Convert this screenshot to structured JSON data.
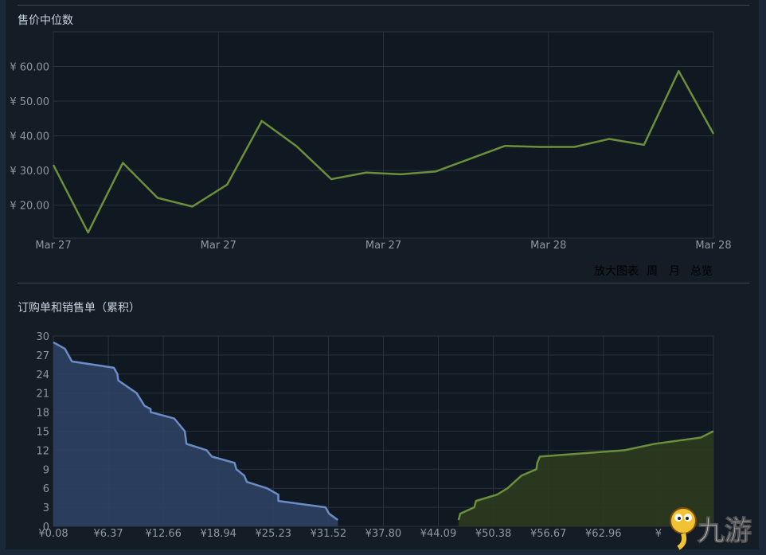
{
  "chart_data": [
    {
      "type": "line",
      "title": "售价中位数",
      "y_tick_labels": [
        "¥ 60.00",
        "¥ 50.00",
        "¥ 40.00",
        "¥ 30.00",
        "¥ 20.00"
      ],
      "y_ticks": [
        60,
        50,
        40,
        30,
        20
      ],
      "x_tick_labels": [
        "Mar 27",
        "Mar 27",
        "Mar 27",
        "Mar 28",
        "Mar 28"
      ],
      "ylim": [
        10.5,
        70
      ],
      "grid": true,
      "series": [
        {
          "color": "#6b8f3a",
          "values": [
            31.6,
            12.1,
            32.2,
            22.1,
            19.6,
            25.9,
            44.3,
            37.0,
            27.5,
            29.4,
            28.9,
            29.7,
            33.4,
            37.1,
            36.8,
            36.8,
            39.1,
            37.4,
            58.7,
            40.6
          ]
        }
      ]
    },
    {
      "type": "area",
      "title": "订购单和销售单（累积）",
      "x_tick_labels": [
        "¥0.08",
        "¥6.37",
        "¥12.66",
        "¥18.94",
        "¥25.23",
        "¥31.52",
        "¥37.80",
        "¥44.09",
        "¥50.38",
        "¥56.67",
        "¥62.96",
        "¥"
      ],
      "x_ticks": [
        0.08,
        6.37,
        12.66,
        18.94,
        25.23,
        31.52,
        37.8,
        44.09,
        50.38,
        56.67,
        62.96,
        69.25
      ],
      "y_ticks": [
        0,
        3,
        6,
        9,
        12,
        15,
        18,
        21,
        24,
        27,
        30
      ],
      "xlim": [
        0.08,
        75.54
      ],
      "ylim": [
        0,
        30
      ],
      "grid": true,
      "series": [
        {
          "color": "#6b8dc5",
          "fill": "#2f4163",
          "points": [
            [
              0.08,
              29
            ],
            [
              1.4,
              28
            ],
            [
              2.2,
              26
            ],
            [
              7.0,
              25
            ],
            [
              7.4,
              24
            ],
            [
              7.5,
              23
            ],
            [
              9.6,
              21
            ],
            [
              10.5,
              19
            ],
            [
              11.2,
              18.5
            ],
            [
              11.2,
              18
            ],
            [
              13.9,
              17
            ],
            [
              15.1,
              15
            ],
            [
              15.3,
              13
            ],
            [
              17.6,
              12
            ],
            [
              18.2,
              11
            ],
            [
              20.8,
              10
            ],
            [
              21.0,
              9
            ],
            [
              21.9,
              8
            ],
            [
              22.2,
              7
            ],
            [
              24.5,
              6
            ],
            [
              25.8,
              5
            ],
            [
              25.8,
              4
            ],
            [
              31.2,
              3
            ],
            [
              31.6,
              2
            ],
            [
              32.6,
              1
            ]
          ]
        },
        {
          "color": "#6b8f3a",
          "fill": "#2c3b1f",
          "points": [
            [
              46.4,
              1
            ],
            [
              46.6,
              2
            ],
            [
              48.2,
              3
            ],
            [
              48.4,
              4
            ],
            [
              50.8,
              5
            ],
            [
              52.0,
              6
            ],
            [
              52.8,
              7
            ],
            [
              53.6,
              8
            ],
            [
              55.3,
              9
            ],
            [
              55.4,
              10
            ],
            [
              55.7,
              11
            ],
            [
              65.4,
              12
            ],
            [
              68.8,
              13
            ],
            [
              74.1,
              14
            ],
            [
              75.54,
              15
            ]
          ]
        }
      ]
    }
  ],
  "zoom": {
    "label": "放大图表",
    "options": [
      "周",
      "月",
      "总览"
    ]
  }
}
